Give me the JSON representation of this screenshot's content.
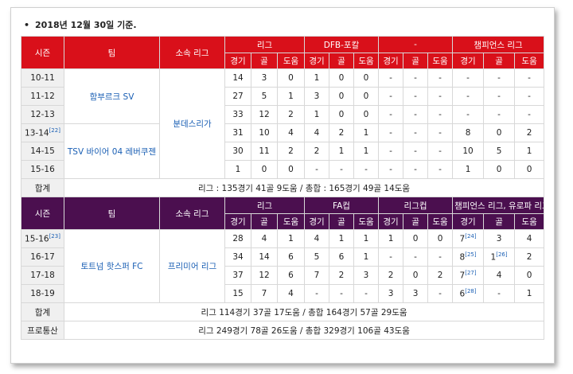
{
  "note": "2018년 12월 30일 기준.",
  "t1": {
    "header": {
      "season": "시즌",
      "team": "팀",
      "league": "소속 리그",
      "groups": [
        "리그",
        "DFB-포칼",
        "-",
        "챔피언스 리그"
      ],
      "sub": [
        "경기",
        "골",
        "도움"
      ]
    },
    "teams": [
      "함부르크 SV",
      "TSV 바이어 04 레버쿠젠"
    ],
    "league_name": "분데스리가",
    "rows": [
      {
        "season": "10-11",
        "ref": "",
        "v": [
          "14",
          "3",
          "0",
          "1",
          "0",
          "0",
          "-",
          "-",
          "-",
          "-",
          "-",
          "-"
        ]
      },
      {
        "season": "11-12",
        "ref": "",
        "v": [
          "27",
          "5",
          "1",
          "3",
          "0",
          "0",
          "-",
          "-",
          "-",
          "-",
          "-",
          "-"
        ]
      },
      {
        "season": "12-13",
        "ref": "",
        "v": [
          "33",
          "12",
          "2",
          "1",
          "0",
          "0",
          "-",
          "-",
          "-",
          "-",
          "-",
          "-"
        ]
      },
      {
        "season": "13-14",
        "ref": "[22]",
        "v": [
          "31",
          "10",
          "4",
          "4",
          "2",
          "1",
          "-",
          "-",
          "-",
          "8",
          "0",
          "2"
        ]
      },
      {
        "season": "14-15",
        "ref": "",
        "v": [
          "30",
          "11",
          "2",
          "2",
          "1",
          "1",
          "-",
          "-",
          "-",
          "10",
          "5",
          "1"
        ]
      },
      {
        "season": "15-16",
        "ref": "",
        "v": [
          "1",
          "0",
          "0",
          "-",
          "-",
          "-",
          "-",
          "-",
          "-",
          "1",
          "0",
          "0"
        ]
      }
    ],
    "total_label": "합계",
    "total_text": "리그 : 135경기 41골 9도움 / 총합 : 165경기 49골 14도움"
  },
  "t2": {
    "header": {
      "season": "시즌",
      "team": "팀",
      "league": "소속 리그",
      "groups": [
        "리그",
        "FA컵",
        "리그컵",
        "챔피언스 리그, 유로파 리그"
      ],
      "sub": [
        "경기",
        "골",
        "도움"
      ]
    },
    "team": "토트넘 핫스퍼 FC",
    "league_name": "프리미어 리그",
    "rows": [
      {
        "season": "15-16",
        "ref": "[23]",
        "v": [
          "28",
          "4",
          "1",
          "4",
          "1",
          "1",
          "1",
          "0",
          "0",
          "7",
          "3",
          "4"
        ],
        "refs": {
          "9": "[24]"
        }
      },
      {
        "season": "16-17",
        "ref": "",
        "v": [
          "34",
          "14",
          "6",
          "5",
          "6",
          "1",
          "-",
          "-",
          "-",
          "8",
          "1",
          "2"
        ],
        "refs": {
          "9": "[25]",
          "10": "[26]"
        }
      },
      {
        "season": "17-18",
        "ref": "",
        "v": [
          "37",
          "12",
          "6",
          "7",
          "2",
          "3",
          "2",
          "0",
          "2",
          "7",
          "4",
          "0"
        ],
        "refs": {
          "9": "[27]"
        }
      },
      {
        "season": "18-19",
        "ref": "",
        "v": [
          "15",
          "7",
          "4",
          "-",
          "-",
          "-",
          "3",
          "3",
          "-",
          "6",
          "-",
          "1"
        ],
        "refs": {
          "9": "[28]"
        }
      }
    ],
    "total_label": "합계",
    "total_text": "리그 114경기 37골 17도움 / 총합 164경기 57골 29도움",
    "career_label": "프로통산",
    "career_text": "리그 249경기 78골 26도움 / 총합 329경기 106골 43도움"
  }
}
